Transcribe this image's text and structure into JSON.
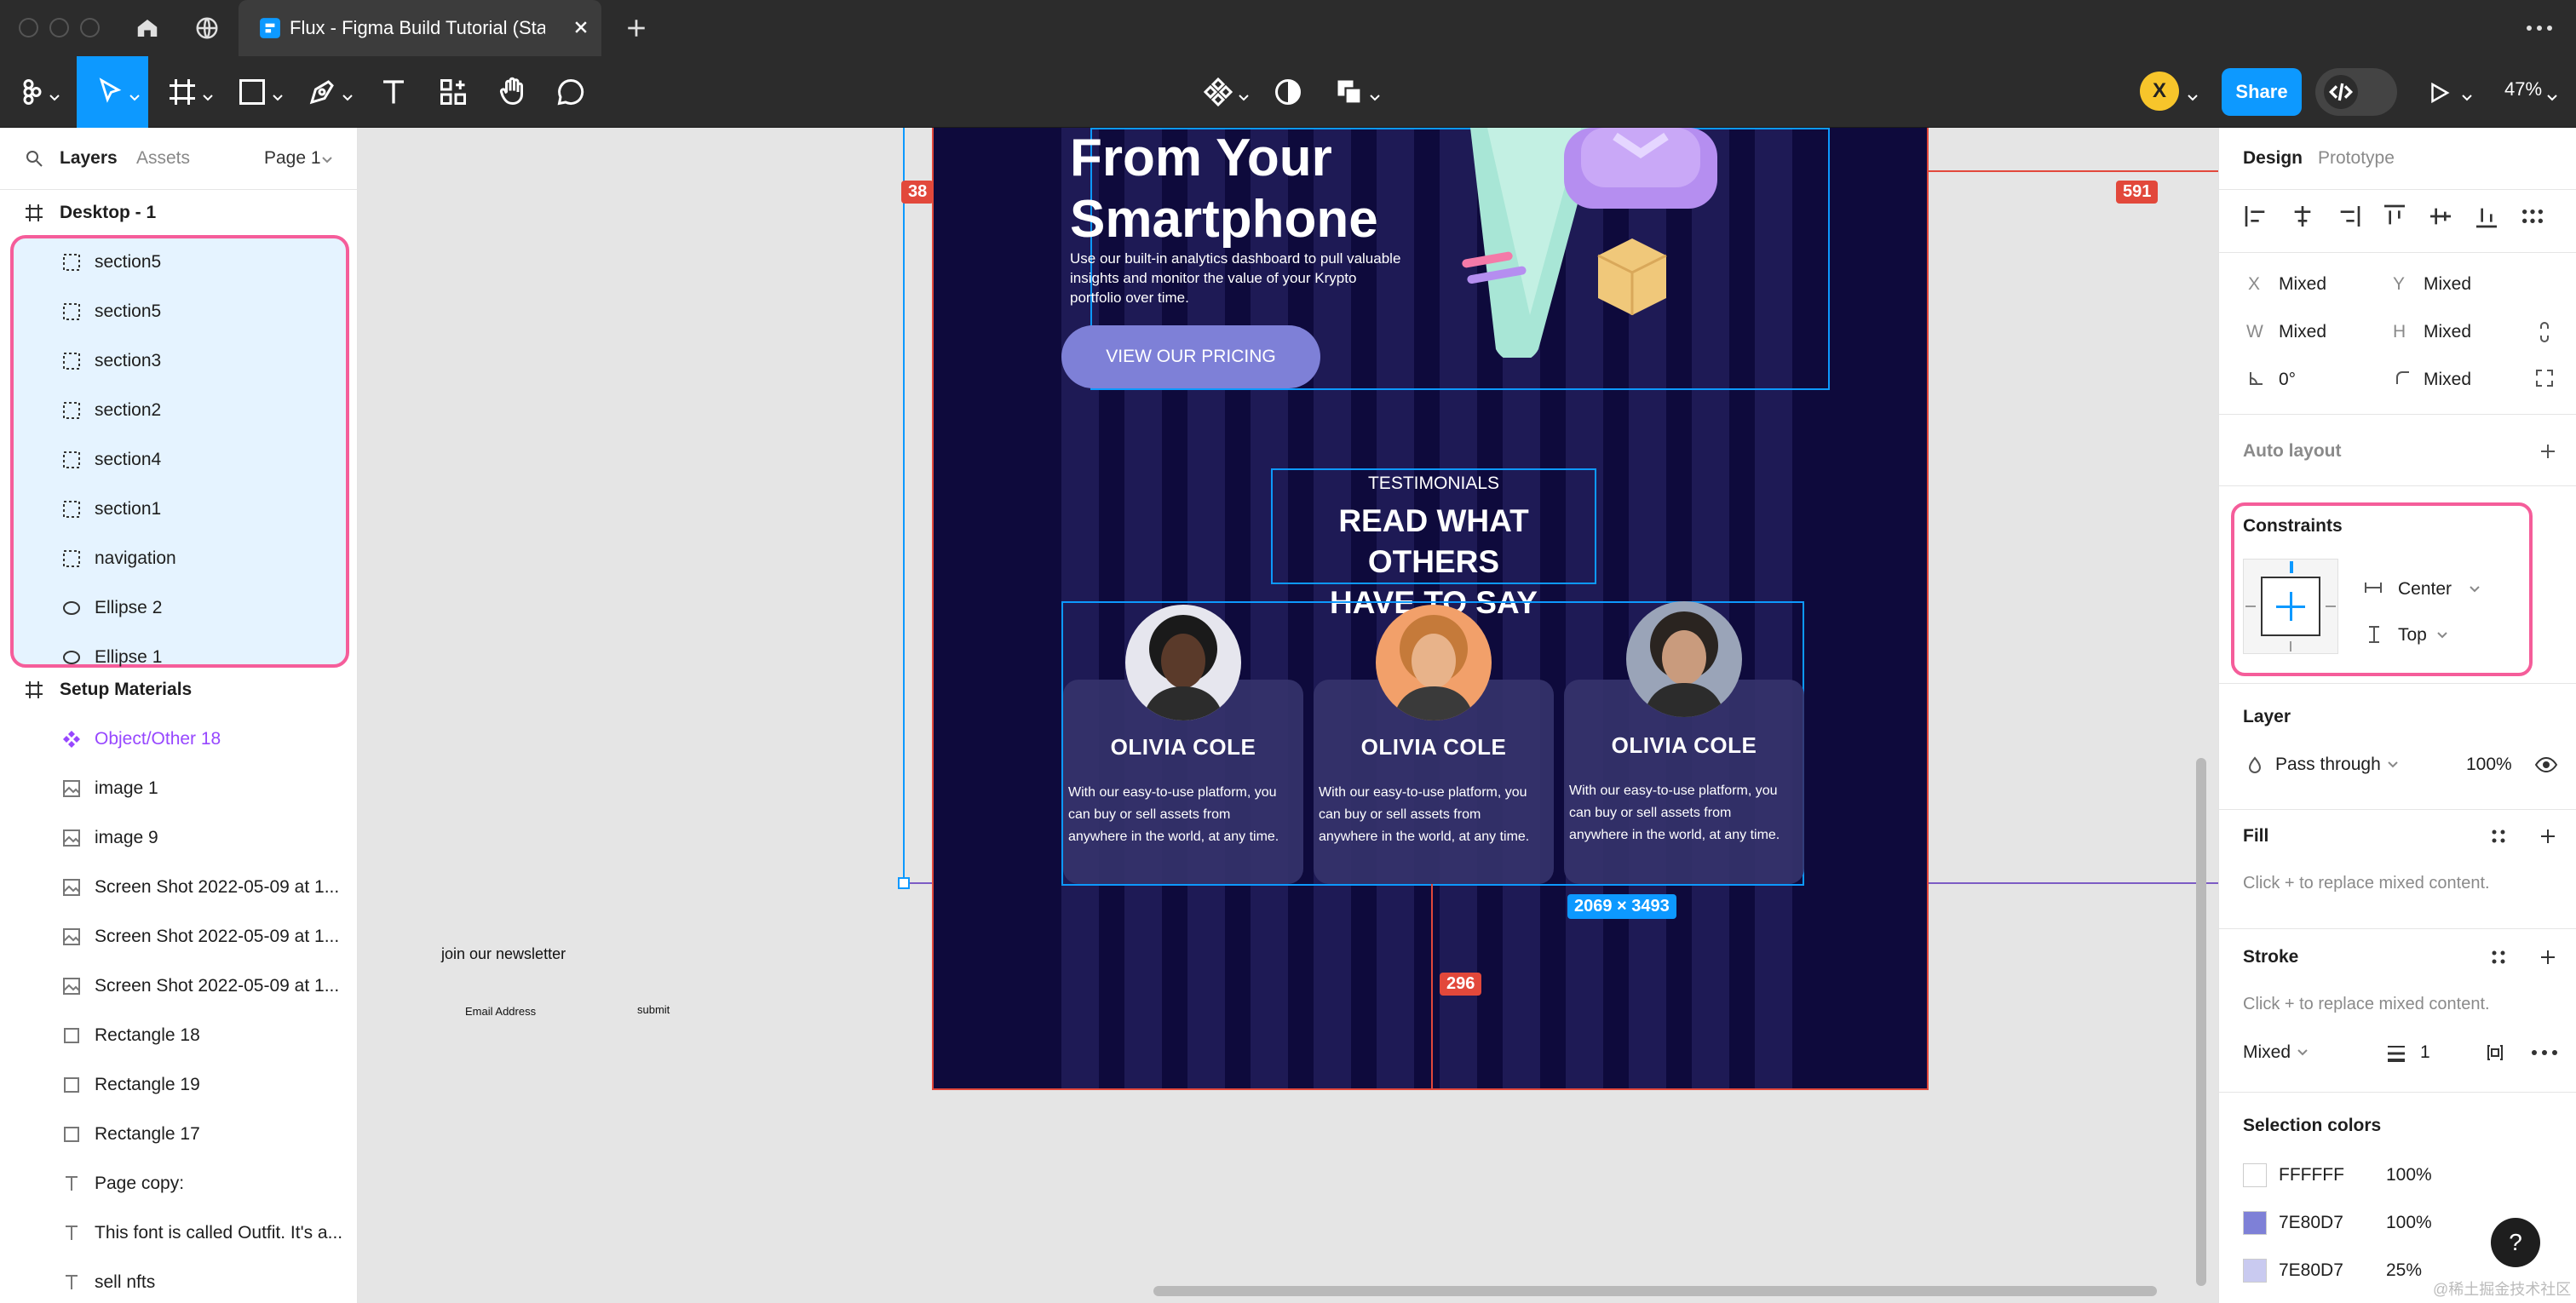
{
  "window": {
    "tab_title": "Flux - Figma Build Tutorial (Starter)"
  },
  "toolbar": {
    "avatar_letter": "X",
    "share_label": "Share",
    "zoom": "47%"
  },
  "left_panel": {
    "tabs": {
      "layers": "Layers",
      "assets": "Assets"
    },
    "page": "Page 1",
    "frame_desktop": "Desktop - 1",
    "desktop_children": [
      {
        "label": "section5",
        "icon": "section-icon"
      },
      {
        "label": "section5",
        "icon": "section-icon"
      },
      {
        "label": "section3",
        "icon": "section-icon"
      },
      {
        "label": "section2",
        "icon": "section-icon"
      },
      {
        "label": "section4",
        "icon": "section-icon"
      },
      {
        "label": "section1",
        "icon": "section-icon"
      },
      {
        "label": "navigation",
        "icon": "section-icon"
      },
      {
        "label": "Ellipse 2",
        "icon": "ellipse-icon"
      },
      {
        "label": "Ellipse 1",
        "icon": "ellipse-icon"
      }
    ],
    "frame_setup": "Setup Materials",
    "setup_children": [
      {
        "label": "Object/Other 18",
        "icon": "component-icon"
      },
      {
        "label": "image 1",
        "icon": "image-icon"
      },
      {
        "label": "image 9",
        "icon": "image-icon"
      },
      {
        "label": "Screen Shot 2022-05-09 at 1...",
        "icon": "image-icon"
      },
      {
        "label": "Screen Shot 2022-05-09 at 1...",
        "icon": "image-icon"
      },
      {
        "label": "Screen Shot 2022-05-09 at 1...",
        "icon": "image-icon"
      },
      {
        "label": "Rectangle 18",
        "icon": "rectangle-icon"
      },
      {
        "label": "Rectangle 19",
        "icon": "rectangle-icon"
      },
      {
        "label": "Rectangle 17",
        "icon": "rectangle-icon"
      },
      {
        "label": "Page copy:",
        "icon": "text-icon"
      },
      {
        "label": "This font is called Outfit. It's a...",
        "icon": "text-icon"
      },
      {
        "label": "sell nfts",
        "icon": "text-icon"
      }
    ]
  },
  "canvas": {
    "hero_title_line1": "From Your",
    "hero_title_line2": "Smartphone",
    "hero_text": "Use our built-in analytics dashboard to pull valuable insights and monitor the value of your Krypto portfolio over time.",
    "pricing_button": "VIEW OUR PRICING",
    "testimonials_kicker": "TESTIMONIALS",
    "testimonials_title_line1": "READ WHAT OTHERS",
    "testimonials_title_line2": "HAVE TO SAY",
    "cards": [
      {
        "name": "OLIVIA COLE",
        "text": "With our easy-to-use platform, you can buy or sell assets from anywhere in the world, at any time."
      },
      {
        "name": "OLIVIA COLE",
        "text": "With our easy-to-use platform, you can buy or sell assets from anywhere in the world, at any time."
      },
      {
        "name": "OLIVIA COLE",
        "text": "With our easy-to-use platform, you can buy or sell assets from anywhere in the world, at any time."
      }
    ],
    "measure_left": "38",
    "measure_right": "591",
    "measure_bottom": "296",
    "selection_size": "2069 × 3493",
    "newsletter_label": "join our newsletter",
    "email_placeholder": "Email Address",
    "submit_label": "submit",
    "selection_color": "#0d99ff",
    "measure_color": "#e2483b"
  },
  "right_panel": {
    "tabs": {
      "design": "Design",
      "prototype": "Prototype"
    },
    "x_label": "X",
    "x_value": "Mixed",
    "y_label": "Y",
    "y_value": "Mixed",
    "w_label": "W",
    "w_value": "Mixed",
    "h_label": "H",
    "h_value": "Mixed",
    "rotation": "0°",
    "radius": "Mixed",
    "auto_layout": "Auto layout",
    "constraints_title": "Constraints",
    "constraint_h": "Center",
    "constraint_v": "Top",
    "layer_title": "Layer",
    "blend_mode": "Pass through",
    "layer_opacity": "100%",
    "fill_title": "Fill",
    "fill_hint": "Click + to replace mixed content.",
    "stroke_title": "Stroke",
    "stroke_hint": "Click + to replace mixed content.",
    "stroke_position": "Mixed",
    "stroke_weight": "1",
    "selection_colors_title": "Selection colors",
    "selection_colors": [
      {
        "hex": "FFFFFF",
        "opacity": "100%",
        "swatch": "#ffffff"
      },
      {
        "hex": "7E80D7",
        "opacity": "100%",
        "swatch": "#7e80d7"
      },
      {
        "hex": "7E80D7",
        "opacity": "25%",
        "swatch": "#c9caf0"
      }
    ]
  },
  "help_label": "?",
  "watermark": "@稀土掘金技术社区"
}
